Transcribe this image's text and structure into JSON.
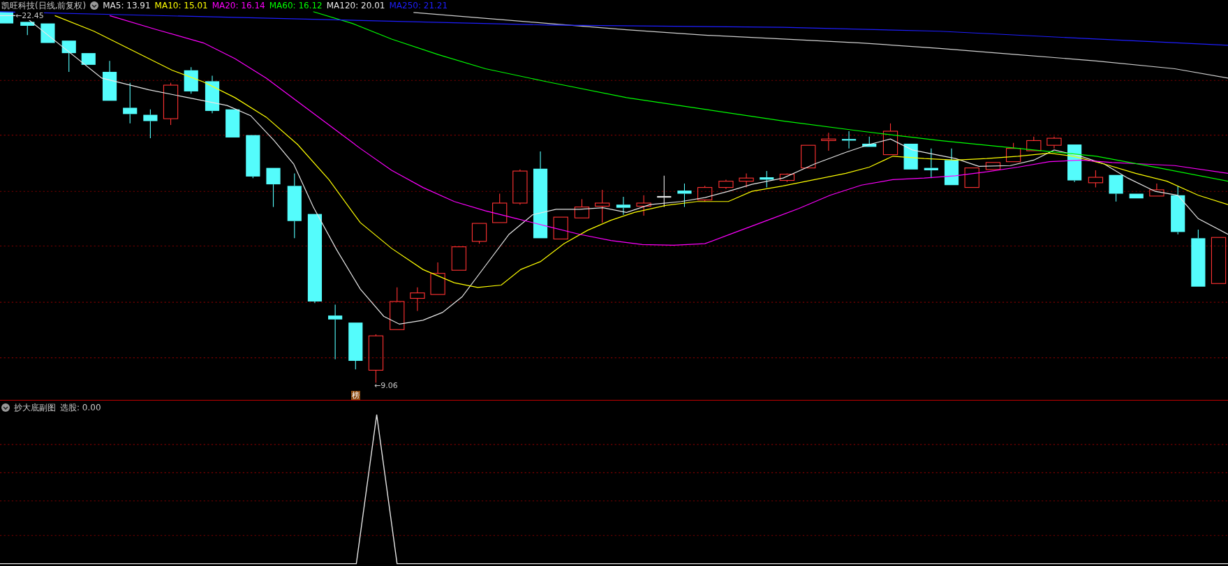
{
  "title": "凯旺科技(日线,前复权)",
  "indicators": [
    {
      "label": "MA5: 13.91",
      "color": "#e6e6e6"
    },
    {
      "label": "MA10: 15.01",
      "color": "#ffff00"
    },
    {
      "label": "MA20: 16.14",
      "color": "#ff00ff"
    },
    {
      "label": "MA60: 16.12",
      "color": "#00ff00"
    },
    {
      "label": "MA120: 20.01",
      "color": "#e6e6e6"
    },
    {
      "label": "MA250: 21.21",
      "color": "#1e1eff"
    }
  ],
  "price_chart": {
    "high_label": "←22.45",
    "low_label": "←9.06",
    "badge": "榜"
  },
  "sub_panel": {
    "title": "抄大底副图",
    "reading": "选股: 0.00"
  }
}
